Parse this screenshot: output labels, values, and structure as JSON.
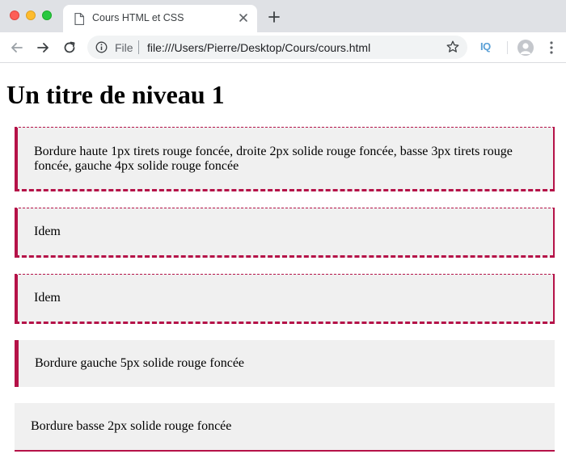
{
  "browser": {
    "tab_title": "Cours HTML et CSS",
    "scheme_label": "File",
    "url": "file:///Users/Pierre/Desktop/Cours/cours.html",
    "extension_label": "IQ"
  },
  "page": {
    "heading": "Un titre de niveau 1",
    "boxes": [
      {
        "text": "Bordure haute 1px tirets rouge foncée, droite 2px solide rouge foncée, basse 3px tirets rouge foncée, gauche 4px solide rouge foncée"
      },
      {
        "text": "Idem"
      },
      {
        "text": "Idem"
      },
      {
        "text": "Bordure gauche 5px solide rouge foncée"
      },
      {
        "text": "Bordure basse 2px solide rouge foncée"
      }
    ]
  },
  "colors": {
    "border_accent": "#b51248",
    "box_background": "#f0f0f0",
    "tabbar_background": "#dfe1e5"
  }
}
